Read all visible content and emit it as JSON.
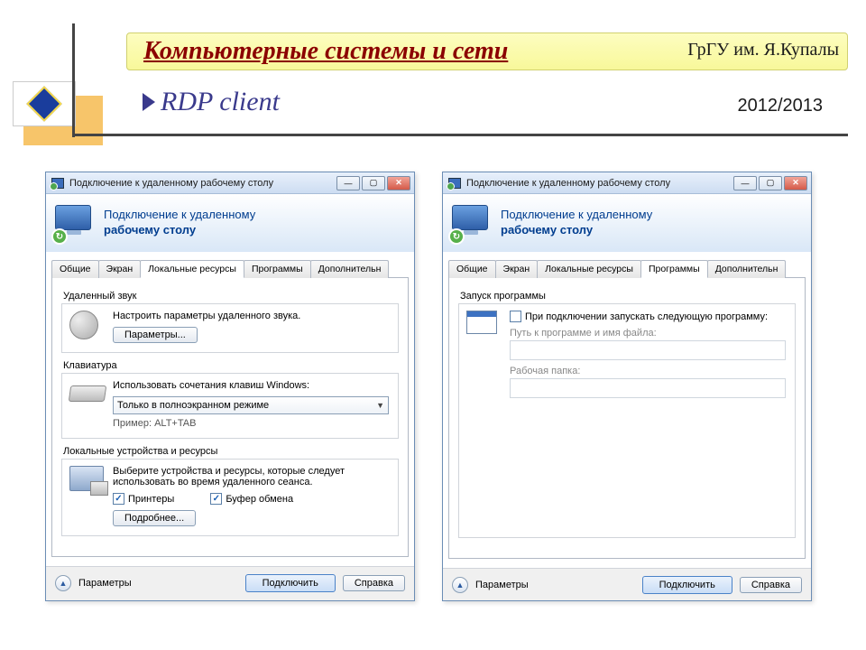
{
  "slide": {
    "course_title": "Компьютерные системы и сети",
    "university": "ГрГУ им. Я.Купалы",
    "year": "2012/2013",
    "topic": "RDP client"
  },
  "dialog": {
    "title": "Подключение к удаленному рабочему столу",
    "banner_line1": "Подключение к удаленному",
    "banner_line2": "рабочему столу",
    "tabs": {
      "general": "Общие",
      "screen": "Экран",
      "local": "Локальные ресурсы",
      "programs": "Программы",
      "advanced": "Дополнительн"
    },
    "footer": {
      "params": "Параметры",
      "connect": "Подключить",
      "help": "Справка"
    }
  },
  "left": {
    "sound": {
      "title": "Удаленный звук",
      "desc": "Настроить параметры удаленного звука.",
      "button": "Параметры..."
    },
    "keyboard": {
      "title": "Клавиатура",
      "desc": "Использовать сочетания клавиш Windows:",
      "combo": "Только в полноэкранном режиме",
      "example": "Пример: ALT+TAB"
    },
    "devices": {
      "title": "Локальные устройства и ресурсы",
      "desc": "Выберите устройства и ресурсы, которые следует использовать во время удаленного сеанса.",
      "printers": "Принтеры",
      "clipboard": "Буфер обмена",
      "more": "Подробнее..."
    }
  },
  "right": {
    "launch": {
      "title": "Запуск программы",
      "checkbox": "При подключении запускать следующую программу:",
      "path_label": "Путь к программе и имя файла:",
      "folder_label": "Рабочая папка:"
    }
  }
}
